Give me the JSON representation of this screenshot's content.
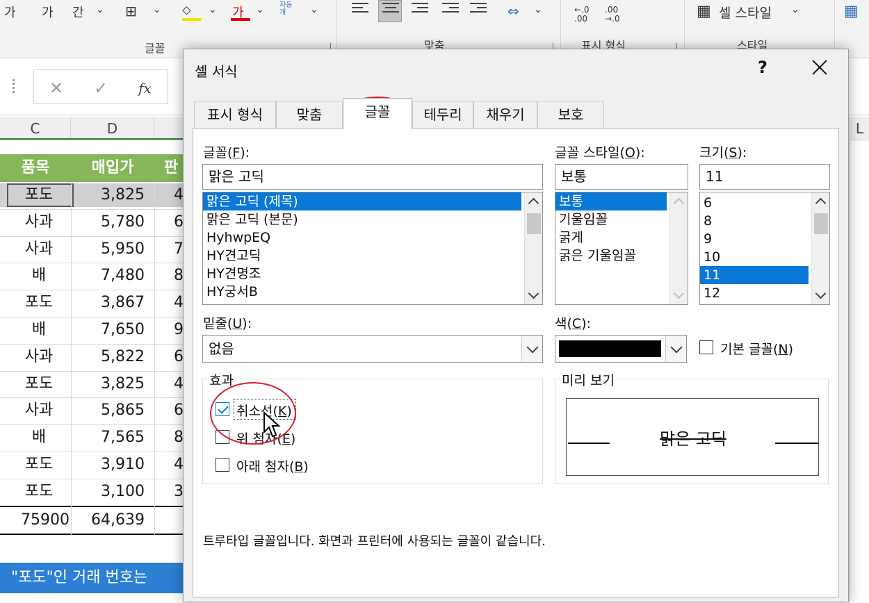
{
  "ribbon": {
    "groups": [
      "글꼴",
      "맞춤",
      "표시 형식",
      "스타일"
    ],
    "cell_style_label": "셀 스타일",
    "font_color_glyph": "가",
    "font_letters": [
      "가",
      "가",
      "간"
    ],
    "wrap_label": "자동\n개",
    "num_inc": "←.0\n.00",
    "num_dec": ".00\n→.0"
  },
  "formula_bar": {
    "cancel": "✕",
    "enter": "✓",
    "fx": "fx"
  },
  "sheet": {
    "col_headers": [
      "C",
      "D"
    ],
    "col_headers_right": [
      "L"
    ],
    "header_row": [
      "품목",
      "매입가",
      "판"
    ],
    "rows": [
      {
        "item": "포도",
        "price": "3,825",
        "next": "4"
      },
      {
        "item": "사과",
        "price": "5,780",
        "next": "6"
      },
      {
        "item": "사과",
        "price": "5,950",
        "next": "7"
      },
      {
        "item": "배",
        "price": "7,480",
        "next": "8"
      },
      {
        "item": "포도",
        "price": "3,867",
        "next": "4"
      },
      {
        "item": "배",
        "price": "7,650",
        "next": "9"
      },
      {
        "item": "사과",
        "price": "5,822",
        "next": "6"
      },
      {
        "item": "포도",
        "price": "3,825",
        "next": "4"
      },
      {
        "item": "사과",
        "price": "5,865",
        "next": "6"
      },
      {
        "item": "배",
        "price": "7,565",
        "next": "8"
      },
      {
        "item": "포도",
        "price": "3,910",
        "next": "4"
      },
      {
        "item": "포도",
        "price": "3,100",
        "next": "3"
      }
    ],
    "total_row": {
      "c": "75900",
      "d": "64,639"
    },
    "banner": "\"포도\"인 거래 번호는"
  },
  "dialog": {
    "title": "셀 서식",
    "help": "?",
    "tabs": [
      "표시 형식",
      "맞춤",
      "글꼴",
      "테두리",
      "채우기",
      "보호"
    ],
    "active_tab": "글꼴",
    "font": {
      "label": "글꼴(",
      "key": "F",
      "label_end": "):",
      "value": "맑은 고딕",
      "list": [
        "맑은 고딕 (제목)",
        "맑은 고딕 (본문)",
        "HyhwpEQ",
        "HY견고딕",
        "HY견명조",
        "HY궁서B"
      ]
    },
    "style": {
      "label": "글꼴 스타일(",
      "key": "O",
      "label_end": "):",
      "value": "보통",
      "list": [
        "보통",
        "기울임꼴",
        "굵게",
        "굵은 기울임꼴"
      ]
    },
    "size": {
      "label": "크기(",
      "key": "S",
      "label_end": "):",
      "value": "11",
      "list": [
        "6",
        "8",
        "9",
        "10",
        "11",
        "12"
      ]
    },
    "underline": {
      "label": "밑줄(",
      "key": "U",
      "label_end": "):",
      "value": "없음"
    },
    "color": {
      "label": "색(",
      "key": "C",
      "label_end": "):",
      "swatch": "#000000"
    },
    "normal_font": {
      "label": "기본 글꼴(",
      "key": "N",
      "label_end": ")",
      "checked": false
    },
    "effects": {
      "title": "효과",
      "strikethrough": {
        "label": "취소선(",
        "key": "K",
        "label_end": ")",
        "checked": true
      },
      "superscript": {
        "label": "위 첨자(",
        "key": "E",
        "label_end": ")",
        "checked": false
      },
      "subscript": {
        "label": "아래 첨자(",
        "key": "B",
        "label_end": ")",
        "checked": false
      }
    },
    "preview": {
      "title": "미리 보기",
      "text": "맑은 고딕"
    },
    "note": "트루타입 글꼴입니다. 화면과 프린터에 사용되는 글꼴이 같습니다."
  },
  "colors": {
    "accent": "#0a78d7",
    "header_green": "#86b55a",
    "banner_blue": "#2d7fd3",
    "annotation_red": "#d9202b"
  }
}
